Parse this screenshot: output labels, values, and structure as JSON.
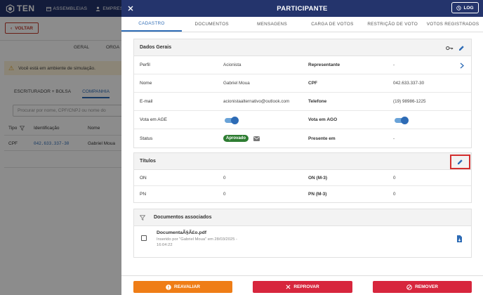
{
  "background": {
    "logo_text": "TEN",
    "nav": [
      "ASSEMBLEIAS",
      "EMPRESA"
    ],
    "back_label": "VOLTAR",
    "tabs": [
      "GERAL",
      "ORGA"
    ],
    "alert": "Você está em ambiente de simulação.",
    "subtabs": [
      "ESCRITURADOR + BOLSA",
      "COMPANHIA"
    ],
    "search_placeholder": "Procurar por nome, CPF/CNPJ ou nome do",
    "columns": [
      "Tipo",
      "Identificação",
      "Nome"
    ],
    "row": {
      "tipo": "CPF",
      "identificacao": "042.633.337-30",
      "nome": "Gabriel Moua"
    }
  },
  "drawer": {
    "title": "PARTICIPANTE",
    "log_label": "LOG",
    "tabs": [
      "CADASTRO",
      "DOCUMENTOS",
      "MENSAGENS",
      "CARGA DE VOTOS",
      "RESTRIÇÃO DE VOTO",
      "VOTOS REGISTRADOS"
    ],
    "active_tab": "CADASTRO",
    "dados": {
      "title": "Dados Gerais",
      "perfil_label": "Perfil",
      "perfil_value": "Acionista",
      "representante_label": "Representante",
      "representante_value": "-",
      "nome_label": "Nome",
      "nome_value": "Gabriel Moua",
      "cpf_label": "CPF",
      "cpf_value": "042.633.337-30",
      "email_label": "E-mail",
      "email_value": "acionistaalternativo@outlook.com",
      "telefone_label": "Telefone",
      "telefone_value": "(19) 98986-1225",
      "age_label": "Vota em AGE",
      "ago_label": "Vota em AGO",
      "status_label": "Status",
      "status_value": "Aprovado",
      "presente_label": "Presente em",
      "presente_value": "-"
    },
    "titulos": {
      "title": "Títulos",
      "on_label": "ON",
      "on_value": "0",
      "on_m3_label": "ON (M-3)",
      "on_m3_value": "0",
      "pn_label": "PN",
      "pn_value": "0",
      "pn_m3_label": "PN (M-3)",
      "pn_m3_value": "0"
    },
    "documentos": {
      "title": "Documentos associados",
      "file_name": "DocumentaÃ§Ã£o.pdf",
      "file_meta": "Inserido por \"Gabriel Moua\" em 28/03/2025 - 16:04:22"
    },
    "footer": {
      "reavaliar": "REAVALIAR",
      "reprovar": "REPROVAR",
      "remover": "REMOVER"
    }
  },
  "colors": {
    "header": "#24346c",
    "accent": "#2d6bb5",
    "reavaliar": "#ef7d16",
    "reprovar": "#d7263d",
    "remover": "#d7263d",
    "approved": "#2e7d32"
  }
}
